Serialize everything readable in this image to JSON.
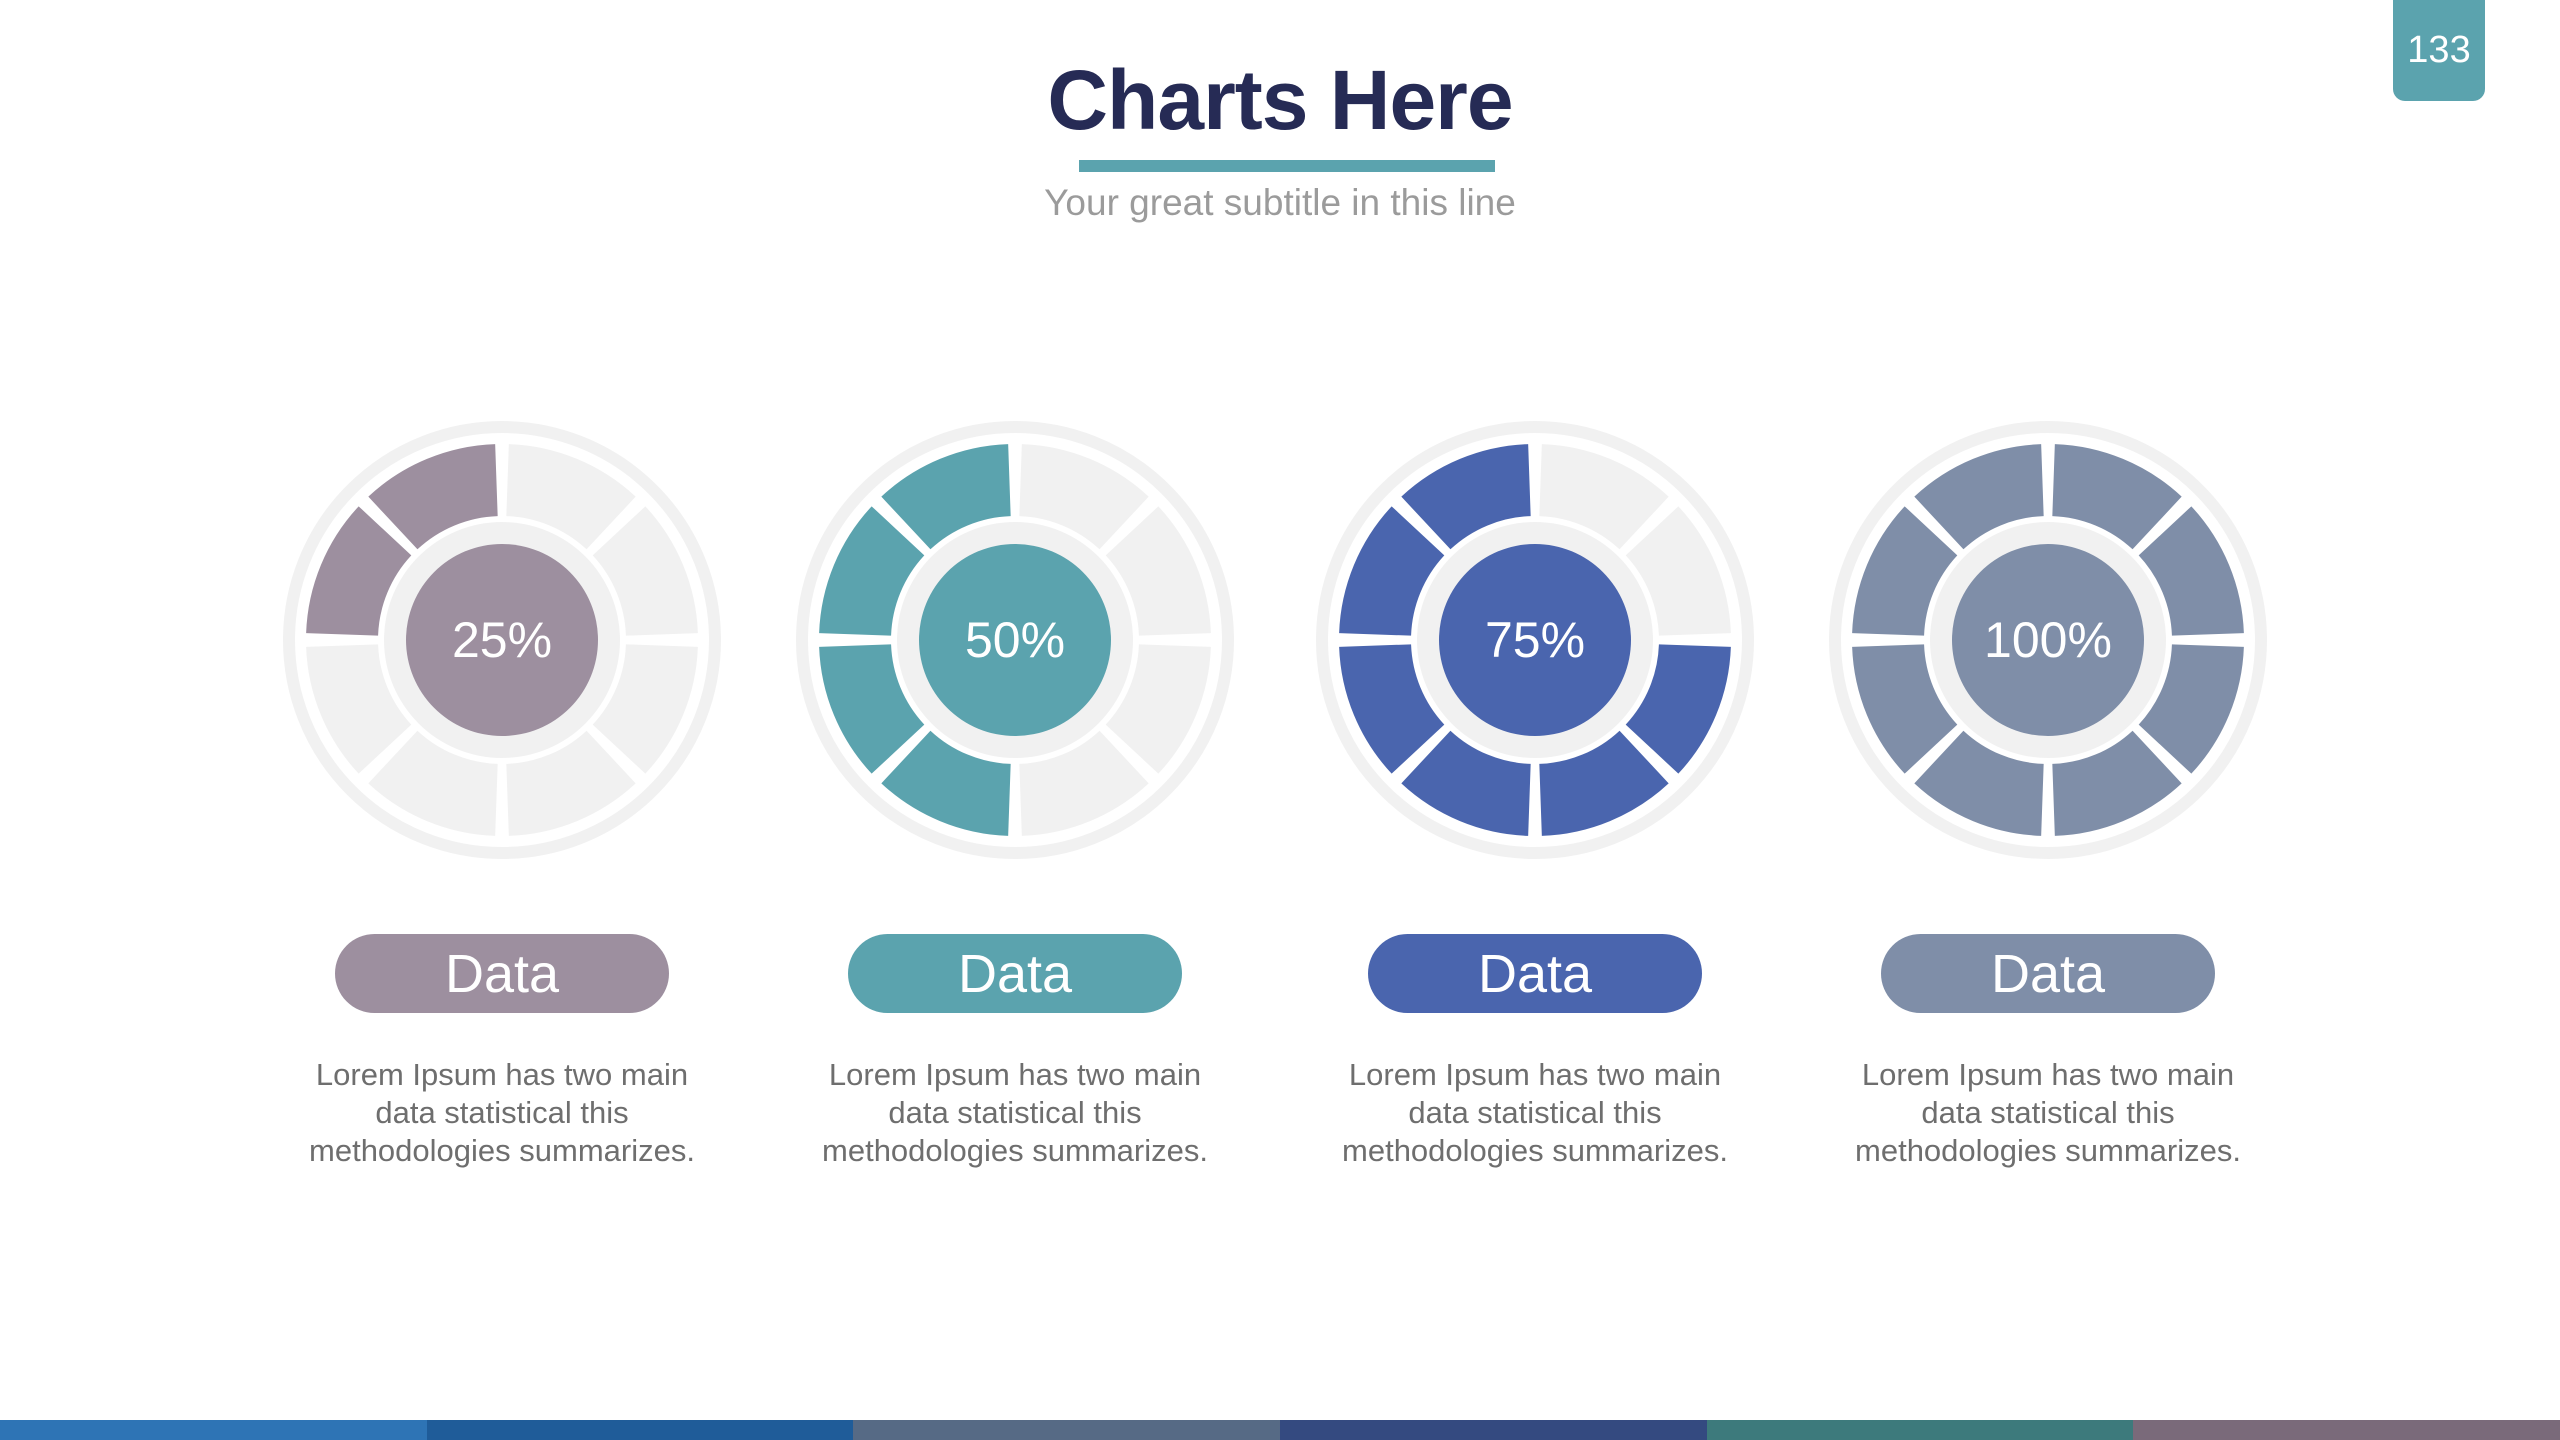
{
  "page": {
    "number": "133",
    "title": "Charts Here",
    "subtitle": "Your great subtitle in this line"
  },
  "colors": {
    "title": "#262b55",
    "accent": "#5ba3ae",
    "track": "#f1f1f1",
    "text": "#6e6e6e"
  },
  "chart_data": [
    {
      "type": "pie",
      "value": 25,
      "label": "25%",
      "tag": "Data",
      "color": "#9d8f9f",
      "description": "Lorem Ipsum has two main data statistical this methodologies summarizes."
    },
    {
      "type": "pie",
      "value": 50,
      "label": "50%",
      "tag": "Data",
      "color": "#5ba3ae",
      "description": "Lorem Ipsum has two main data statistical this methodologies summarizes."
    },
    {
      "type": "pie",
      "value": 75,
      "label": "75%",
      "tag": "Data",
      "color": "#4a65ae",
      "description": "Lorem Ipsum has two main data statistical this methodologies summarizes."
    },
    {
      "type": "pie",
      "value": 100,
      "label": "100%",
      "tag": "Data",
      "color": "#7f8ea8",
      "description": "Lorem Ipsum has two main data statistical this methodologies summarizes."
    }
  ],
  "footer": {
    "colors": [
      "#2e74b5",
      "#1f5c99",
      "#566a85",
      "#344a80",
      "#3d7a7c",
      "#7a6a7a"
    ]
  }
}
